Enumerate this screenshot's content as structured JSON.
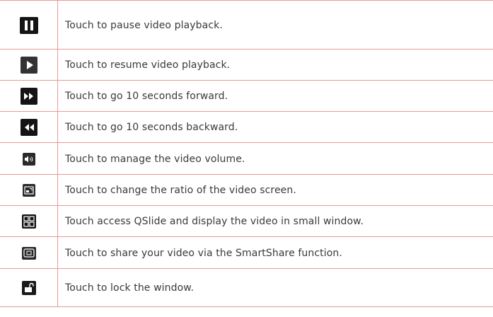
{
  "rows": [
    {
      "icon": "pause-icon",
      "text": "Touch to pause video playback."
    },
    {
      "icon": "play-icon",
      "text": "Touch to resume video playback."
    },
    {
      "icon": "fast-forward-icon",
      "text": "Touch to go 10 seconds forward."
    },
    {
      "icon": "rewind-icon",
      "text": "Touch to go 10 seconds backward."
    },
    {
      "icon": "volume-icon",
      "text": "Touch to manage the video volume."
    },
    {
      "icon": "screen-ratio-icon",
      "text": "Touch to change the ratio of the video screen."
    },
    {
      "icon": "qslide-icon",
      "text": "Touch access QSlide and display the video in small window."
    },
    {
      "icon": "smartshare-icon",
      "text": "Touch to share your video via the SmartShare function."
    },
    {
      "icon": "lock-icon",
      "text": "Touch to lock the window."
    }
  ]
}
